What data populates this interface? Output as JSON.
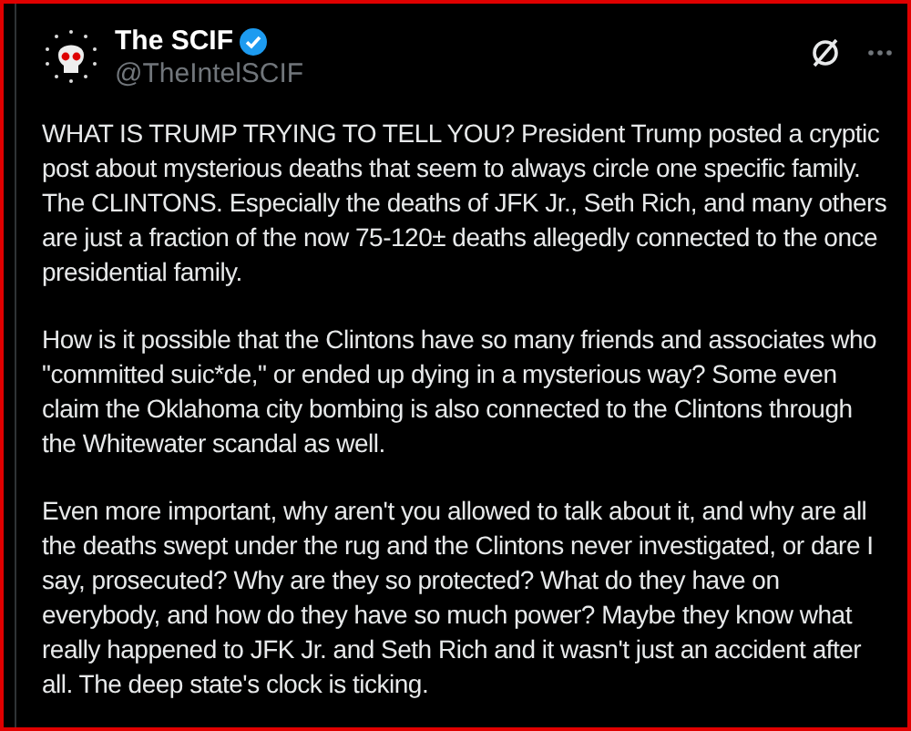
{
  "post": {
    "author": {
      "name": "The SCIF",
      "verified": true,
      "handle": "@TheIntelSCIF"
    },
    "paragraphs": [
      "WHAT IS TRUMP TRYING TO TELL YOU? President Trump posted a cryptic post about mysterious deaths that seem to always circle one specific family. The CLINTONS. Especially the deaths of JFK Jr., Seth Rich, and many others are just a fraction of the now 75-120± deaths allegedly connected to the once presidential family.",
      "How is it possible that the Clintons have so many friends and associates who \"committed suic*de,\" or ended up dying in a mysterious way? Some even claim the Oklahoma city bombing is also connected to the Clintons through the Whitewater scandal as well.",
      "Even more important, why aren't you allowed to talk about it, and why are all the deaths swept under the rug and the Clintons never investigated, or dare I say, prosecuted? Why are they so protected? What do they have on everybody, and how do they have so much power? Maybe they know what really happened to JFK Jr. and Seth Rich and it wasn't just an accident after all. The deep state's clock is ticking."
    ]
  }
}
